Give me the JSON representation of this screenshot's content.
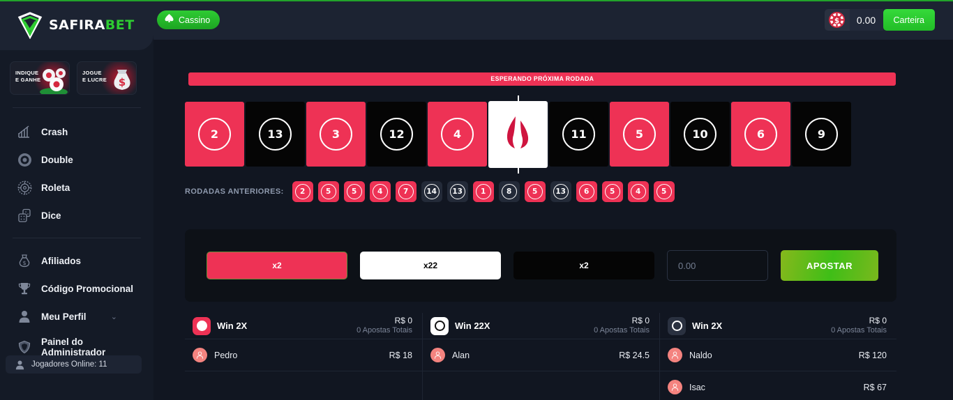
{
  "brand": {
    "name_white": "SAFIRA",
    "name_green": "BET",
    "logo_icon": "gem-diamond-icon",
    "accent_green": "#2ecc31",
    "accent_red": "#ee3255"
  },
  "sidebar": {
    "promos": [
      {
        "line1": "INDIQUE",
        "line2": "E GANHE",
        "icon": "casino-chips-icon"
      },
      {
        "line1": "JOGUE",
        "line2": "E LUCRE",
        "icon": "money-bag-icon"
      }
    ],
    "group1": [
      {
        "label": "Crash",
        "icon": "bar-chart-icon"
      },
      {
        "label": "Double",
        "icon": "circle-target-icon"
      },
      {
        "label": "Roleta",
        "icon": "roulette-wheel-icon"
      },
      {
        "label": "Dice",
        "icon": "dice-icon"
      }
    ],
    "group2": [
      {
        "label": "Afiliados",
        "icon": "money-bag-icon"
      },
      {
        "label": "Código Promocional",
        "icon": "trophy-icon"
      },
      {
        "label": "Meu Perfil",
        "icon": "user-icon",
        "chevron": "⌄"
      },
      {
        "label": "Painel do Administrador",
        "icon": "shield-icon"
      }
    ],
    "online": {
      "label": "Jogadores Online: 11",
      "icon": "user-icon"
    }
  },
  "header": {
    "cassino_label": "Cassino",
    "cassino_icon": "spade-icon",
    "chip_icon": "casino-chip-icon",
    "balance": "0.00",
    "wallet_label": "Carteira"
  },
  "game": {
    "status": "ESPERANDO PRÓXIMA RODADA",
    "cards": [
      {
        "value": "2",
        "color": "red"
      },
      {
        "value": "13",
        "color": "black"
      },
      {
        "value": "3",
        "color": "red"
      },
      {
        "value": "12",
        "color": "black"
      },
      {
        "value": "4",
        "color": "red"
      },
      {
        "value": "",
        "color": "white",
        "icon": "flame-icon",
        "current": true
      },
      {
        "value": "11",
        "color": "black"
      },
      {
        "value": "5",
        "color": "red"
      },
      {
        "value": "10",
        "color": "black"
      },
      {
        "value": "6",
        "color": "red"
      },
      {
        "value": "9",
        "color": "black"
      }
    ],
    "previous_label": "RODADAS ANTERIORES:",
    "previous": [
      {
        "value": "2",
        "color": "red"
      },
      {
        "value": "5",
        "color": "red"
      },
      {
        "value": "5",
        "color": "red"
      },
      {
        "value": "4",
        "color": "red"
      },
      {
        "value": "7",
        "color": "red"
      },
      {
        "value": "14",
        "color": "dark"
      },
      {
        "value": "13",
        "color": "dark"
      },
      {
        "value": "1",
        "color": "red"
      },
      {
        "value": "8",
        "color": "dark"
      },
      {
        "value": "5",
        "color": "red"
      },
      {
        "value": "13",
        "color": "dark"
      },
      {
        "value": "6",
        "color": "red"
      },
      {
        "value": "5",
        "color": "red"
      },
      {
        "value": "4",
        "color": "red"
      },
      {
        "value": "5",
        "color": "red"
      }
    ]
  },
  "bet": {
    "options": [
      {
        "label": "x2",
        "style": "red",
        "selected": true
      },
      {
        "label": "x22",
        "style": "white",
        "selected": false
      },
      {
        "label": "x2",
        "style": "black",
        "selected": false
      }
    ],
    "amount_value": "",
    "amount_placeholder": "0.00",
    "submit_label": "APOSTAR"
  },
  "columns": [
    {
      "title": "Win 2X",
      "badge": "red",
      "total": "R$ 0",
      "subtitle": "0 Apostas Totais",
      "players": [
        {
          "name": "Pedro",
          "amount": "R$ 18"
        }
      ]
    },
    {
      "title": "Win 22X",
      "badge": "white",
      "total": "R$ 0",
      "subtitle": "0 Apostas Totais",
      "players": [
        {
          "name": "Alan",
          "amount": "R$ 24.5"
        }
      ]
    },
    {
      "title": "Win 2X",
      "badge": "dark",
      "total": "R$ 0",
      "subtitle": "0 Apostas Totais",
      "players": [
        {
          "name": "Naldo",
          "amount": "R$ 120"
        },
        {
          "name": "Isac",
          "amount": "R$ 67"
        }
      ]
    }
  ]
}
